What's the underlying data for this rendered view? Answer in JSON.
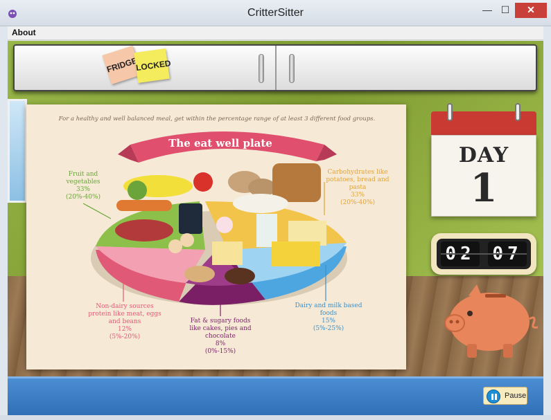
{
  "window": {
    "title": "CritterSitter",
    "controls": {
      "minimize": "—",
      "maximize": "☐",
      "close": "✕"
    }
  },
  "menu": {
    "items": [
      {
        "label": "About"
      }
    ]
  },
  "fridge": {
    "notes": [
      {
        "text": "FRIDGE"
      },
      {
        "text": "LOCKED"
      }
    ]
  },
  "poster": {
    "intro": "For a healthy and well balanced meal, get within the percentage range of at least 3 different food groups.",
    "title": "The eat well plate",
    "groups": {
      "fruit": {
        "name": "Fruit and vegetables",
        "pct": "33%",
        "range": "(20%-40%)"
      },
      "carbs": {
        "name": "Carbohydrates like potatoes, bread and pasta",
        "pct": "33%",
        "range": "(20%-40%)"
      },
      "protein": {
        "name": "Non-dairy sources protein like meat, eggs and beans",
        "pct": "12%",
        "range": "(5%-20%)"
      },
      "fat": {
        "name": "Fat & sugary foods like cakes, pies and chocolate",
        "pct": "8%",
        "range": "(0%-15%)"
      },
      "dairy": {
        "name": "Dairy and milk based foods",
        "pct": "15%",
        "range": "(5%-25%)"
      }
    }
  },
  "calendar": {
    "label": "DAY",
    "number": "1"
  },
  "clock": {
    "hours": "02",
    "minutes": "07"
  },
  "controls": {
    "pause_label": "Pause"
  },
  "colors": {
    "accent_blue": "#2f6fb6",
    "calendar_red": "#c83a32",
    "ribbon_pink": "#e0506e"
  }
}
